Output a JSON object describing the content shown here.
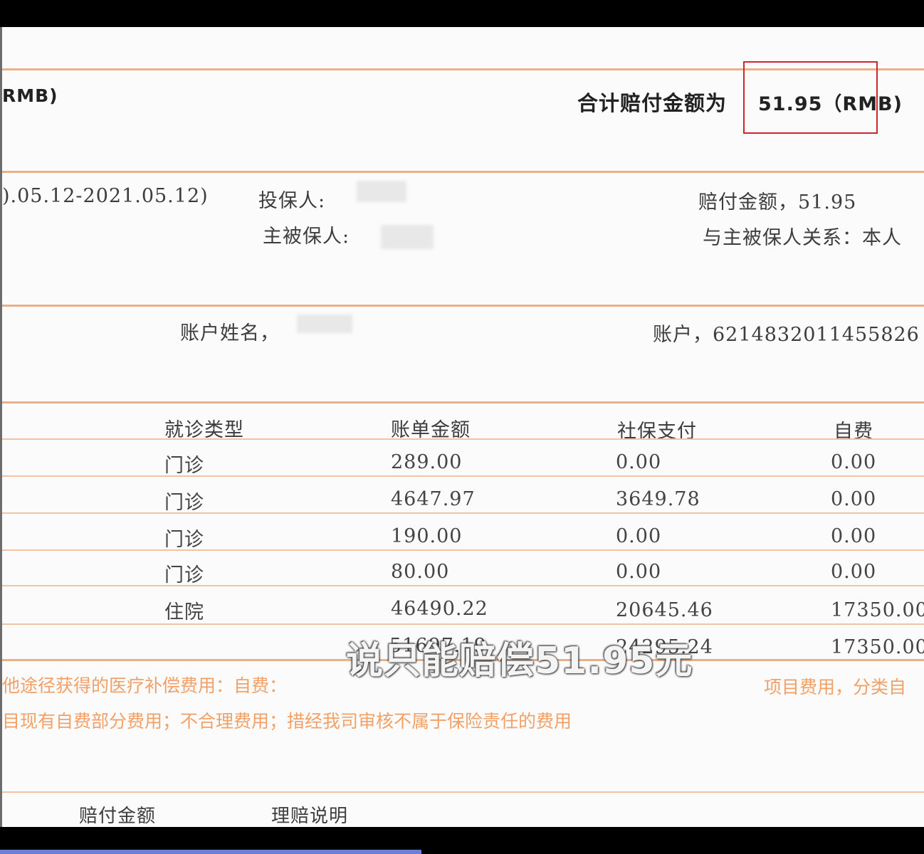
{
  "header": {
    "left_text": "RMB)",
    "total_label": "合计赔付金额为",
    "total_value": "51.95（RMB)"
  },
  "policy": {
    "period": ").05.12-2021.05.12)",
    "policyholder_label": "投保人:",
    "main_insured_label": "主被保人:",
    "claim_amount": "赔付金额，51.95",
    "relation": "与主被保人关系：本人"
  },
  "account": {
    "name_label": "账户姓名，",
    "account": "账户，6214832011455826"
  },
  "table": {
    "headers": [
      "就诊类型",
      "账单金额",
      "社保支付",
      "自费"
    ],
    "rows": [
      {
        "type": "门诊",
        "bill": "289.00",
        "social": "0.00",
        "self": "0.00"
      },
      {
        "type": "门诊",
        "bill": "4647.97",
        "social": "3649.78",
        "self": "0.00"
      },
      {
        "type": "门诊",
        "bill": "190.00",
        "social": "0.00",
        "self": "0.00"
      },
      {
        "type": "门诊",
        "bill": "80.00",
        "social": "0.00",
        "self": "0.00"
      },
      {
        "type": "住院",
        "bill": "46490.22",
        "social": "20645.46",
        "self": "17350.00"
      }
    ],
    "totals": {
      "bill": "51697.19",
      "social": "24295.24",
      "self": "17350.00"
    }
  },
  "notes": {
    "line1_left": "他途径获得的医疗补偿费用：自费：",
    "line1_right": "项目费用，分类自",
    "line2": "目现有自费部分费用；不合理费用；措经我司审核不属于保险责任的费用"
  },
  "footer": {
    "col1": "赔付金额",
    "col2": "理赔说明"
  },
  "subtitle": "说只能赔偿51.95元",
  "colors": {
    "highlight_box": "#d0252a",
    "rule": "#e9b18a",
    "note_text": "#f0924f"
  }
}
